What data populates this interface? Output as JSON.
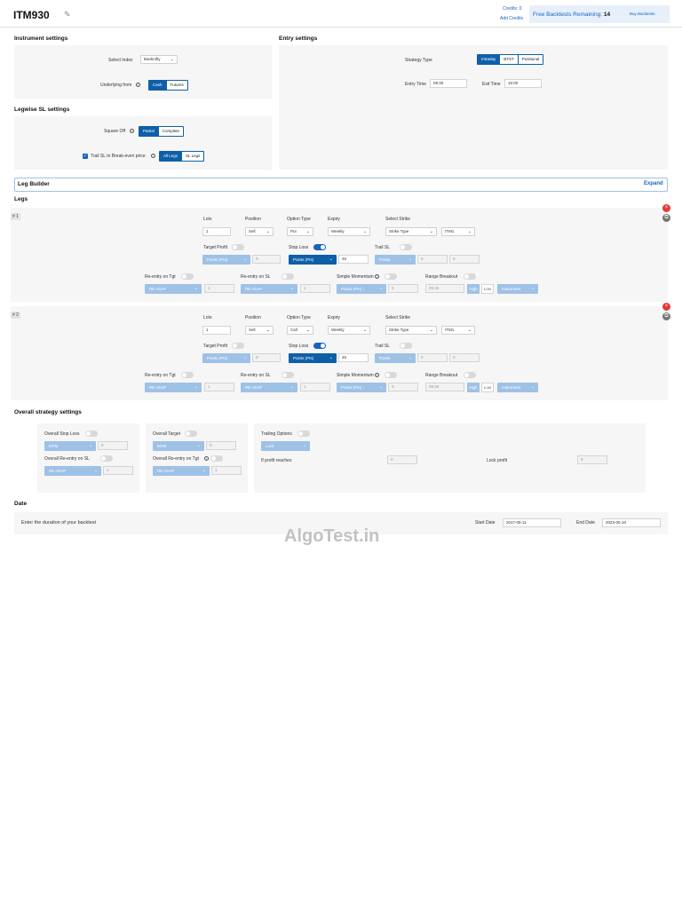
{
  "header": {
    "title": "ITM930",
    "credits": "Credits: 0",
    "add_credits": "Add Credits",
    "free_backtests_label": "Free Backtests Remaining:",
    "free_backtests_count": "14",
    "buy_backtests": "Buy Backtests"
  },
  "instrument": {
    "heading": "Instrument settings",
    "select_index_label": "Select Index",
    "select_index_value": "Banknifty",
    "underlying_label": "Underlying from",
    "underlying_options": [
      "Cash",
      "Futures"
    ]
  },
  "entry": {
    "heading": "Entry settings",
    "strategy_type_label": "Strategy Type",
    "strategy_types": [
      "Intraday",
      "BTST",
      "Positional"
    ],
    "entry_time_label": "Entry Time",
    "entry_time": "09:30",
    "exit_time_label": "Exit Time",
    "exit_time": "15:00"
  },
  "legwise_sl": {
    "heading": "Legwise SL settings",
    "square_off_label": "Square Off",
    "square_off_options": [
      "Partial",
      "Complete"
    ],
    "trail_label": "Trail SL to Break-even price",
    "trail_options": [
      "All Legs",
      "SL Legs"
    ]
  },
  "leg_builder": {
    "label": "Leg Builder",
    "expand": "Expand"
  },
  "legs_heading": "Legs",
  "legs": [
    {
      "num": "# 1",
      "lots_label": "Lots",
      "lots": "1",
      "position_label": "Position",
      "position": "Sell",
      "option_type_label": "Option Type",
      "option_type": "Put",
      "expiry_label": "Expiry",
      "expiry": "Weekly",
      "strike_label": "Select Strike",
      "strike_type": "Strike Type",
      "strike": "ITM1",
      "target_profit_label": "Target Profit",
      "target_profit_unit": "Points (Pts)",
      "target_profit_value": "0",
      "stop_loss_label": "Stop Loss",
      "stop_loss_unit": "Points (Pts)",
      "stop_loss_value": "45",
      "trail_sl_label": "Trail SL",
      "trail_sl_unit": "Points",
      "trail_x": "0",
      "trail_y": "0",
      "reentry_tgt_label": "Re-entry on Tgt",
      "reentry_tgt_value": "RE ASAP",
      "reentry_tgt_count": "1",
      "reentry_sl_label": "Re-entry on SL",
      "reentry_sl_value": "RE ASAP",
      "reentry_sl_count": "1",
      "simple_momentum_label": "Simple Momentum",
      "simple_momentum_unit": "Points (Pts) ↑",
      "simple_momentum_value": "0",
      "range_breakout_label": "Range Breakout",
      "range_time": "09:45",
      "range_high": "High",
      "range_low": "Low",
      "range_instrument": "Instrument"
    },
    {
      "num": "# 2",
      "lots_label": "Lots",
      "lots": "1",
      "position_label": "Position",
      "position": "Sell",
      "option_type_label": "Option Type",
      "option_type": "Call",
      "expiry_label": "Expiry",
      "expiry": "Weekly",
      "strike_label": "Select Strike",
      "strike_type": "Strike Type",
      "strike": "ITM1",
      "target_profit_label": "Target Profit",
      "target_profit_unit": "Points (Pts)",
      "target_profit_value": "0",
      "stop_loss_label": "Stop Loss",
      "stop_loss_unit": "Points (Pts)",
      "stop_loss_value": "45",
      "trail_sl_label": "Trail SL",
      "trail_sl_unit": "Points",
      "trail_x": "0",
      "trail_y": "0",
      "reentry_tgt_label": "Re-entry on Tgt",
      "reentry_tgt_value": "RE ASAP",
      "reentry_tgt_count": "1",
      "reentry_sl_label": "Re-entry on SL",
      "reentry_sl_value": "RE ASAP",
      "reentry_sl_count": "1",
      "simple_momentum_label": "Simple Momentum",
      "simple_momentum_unit": "Points (Pts) ↑",
      "simple_momentum_value": "0",
      "range_breakout_label": "Range Breakout",
      "range_time": "09:45",
      "range_high": "High",
      "range_low": "Low",
      "range_instrument": "Instrument"
    }
  ],
  "overall": {
    "heading": "Overall strategy settings",
    "stop_loss_label": "Overall Stop Loss",
    "stop_loss_unit": "MTM",
    "stop_loss_value": "0",
    "reentry_sl_label": "Overall Re-entry on SL",
    "reentry_sl_value": "RE ASAP",
    "reentry_sl_count": "1",
    "target_label": "Overall Target",
    "target_unit": "MTM",
    "target_value": "0",
    "reentry_tgt_label": "Overall Re-entry on Tgt",
    "reentry_tgt_value": "RE ASAP",
    "reentry_tgt_count": "1",
    "trailing_label": "Trailing Options",
    "trailing_value": "Lock",
    "if_profit_label": "If profit reaches",
    "if_profit_value": "0",
    "lock_profit_label": "Lock profit",
    "lock_profit_value": "0"
  },
  "date": {
    "heading": "Date",
    "description": "Enter the duration of your backtest",
    "start_label": "Start Date",
    "start_value": "2017-05-11",
    "end_label": "End Date",
    "end_value": "2023-05-10"
  },
  "watermark": "AlgoTest.in",
  "colors": {
    "primary": "#0e5fa8",
    "disabled": "#9ec1e6",
    "panel": "#f6f6f6"
  }
}
